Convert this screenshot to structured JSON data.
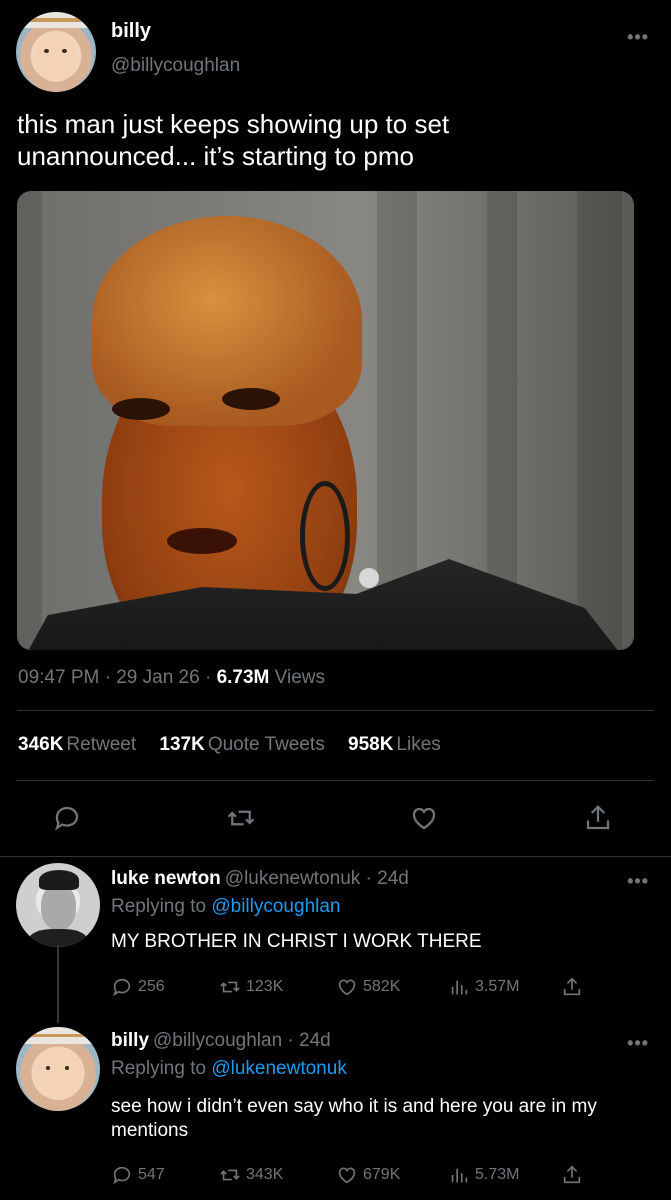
{
  "main_tweet": {
    "name": "billy",
    "handle": "@billycoughlan",
    "text": "this man just keeps showing up to set unannounced... it’s starting to pmo",
    "time": "09:47 PM",
    "date": "29 Jan 26",
    "views_count": "6.73M",
    "views_label": "Views",
    "retweets_count": "346K",
    "retweets_label": "Retweet",
    "quotes_count": "137K",
    "quotes_label": "Quote Tweets",
    "likes_count": "958K",
    "likes_label": "Likes"
  },
  "replies": [
    {
      "name": "luke newton",
      "handle": "@lukenewtonuk",
      "age": "24d",
      "replying_label": "Replying to",
      "replying_to": "@billycoughlan",
      "text": "MY BROTHER IN CHRIST I WORK THERE",
      "replies": "256",
      "retweets": "123K",
      "likes": "582K",
      "views": "3.57M"
    },
    {
      "name": "billy",
      "handle": "@billycoughlan",
      "age": "24d",
      "replying_label": "Replying to",
      "replying_to": "@lukenewtonuk",
      "text": "see how i didn’t even say who it is and here you are in my mentions",
      "replies": "547",
      "retweets": "343K",
      "likes": "679K",
      "views": "5.73M"
    }
  ],
  "icons": {
    "reply": "reply-icon",
    "retweet": "retweet-icon",
    "like": "heart-icon",
    "views": "views-icon",
    "share": "share-icon",
    "more": "more-icon"
  },
  "colors": {
    "background": "#000000",
    "text": "#e7e9ea",
    "muted": "#71767b",
    "link": "#1d9bf0",
    "divider": "#2f3336"
  }
}
